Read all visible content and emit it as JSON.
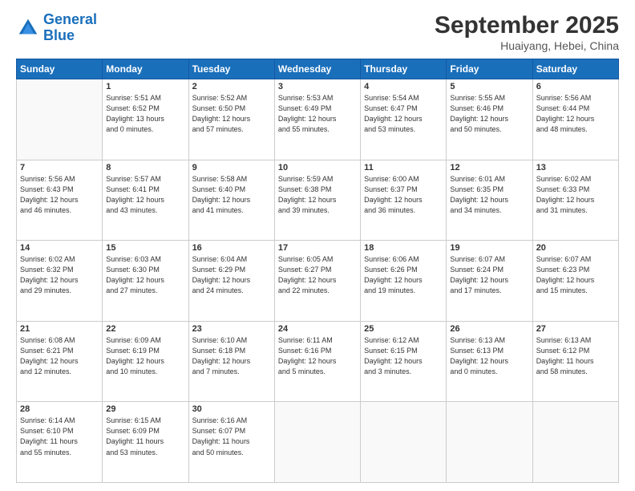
{
  "logo": {
    "line1": "General",
    "line2": "Blue"
  },
  "title": "September 2025",
  "subtitle": "Huaiyang, Hebei, China",
  "weekdays": [
    "Sunday",
    "Monday",
    "Tuesday",
    "Wednesday",
    "Thursday",
    "Friday",
    "Saturday"
  ],
  "weeks": [
    [
      {
        "day": "",
        "info": ""
      },
      {
        "day": "1",
        "info": "Sunrise: 5:51 AM\nSunset: 6:52 PM\nDaylight: 13 hours\nand 0 minutes."
      },
      {
        "day": "2",
        "info": "Sunrise: 5:52 AM\nSunset: 6:50 PM\nDaylight: 12 hours\nand 57 minutes."
      },
      {
        "day": "3",
        "info": "Sunrise: 5:53 AM\nSunset: 6:49 PM\nDaylight: 12 hours\nand 55 minutes."
      },
      {
        "day": "4",
        "info": "Sunrise: 5:54 AM\nSunset: 6:47 PM\nDaylight: 12 hours\nand 53 minutes."
      },
      {
        "day": "5",
        "info": "Sunrise: 5:55 AM\nSunset: 6:46 PM\nDaylight: 12 hours\nand 50 minutes."
      },
      {
        "day": "6",
        "info": "Sunrise: 5:56 AM\nSunset: 6:44 PM\nDaylight: 12 hours\nand 48 minutes."
      }
    ],
    [
      {
        "day": "7",
        "info": "Sunrise: 5:56 AM\nSunset: 6:43 PM\nDaylight: 12 hours\nand 46 minutes."
      },
      {
        "day": "8",
        "info": "Sunrise: 5:57 AM\nSunset: 6:41 PM\nDaylight: 12 hours\nand 43 minutes."
      },
      {
        "day": "9",
        "info": "Sunrise: 5:58 AM\nSunset: 6:40 PM\nDaylight: 12 hours\nand 41 minutes."
      },
      {
        "day": "10",
        "info": "Sunrise: 5:59 AM\nSunset: 6:38 PM\nDaylight: 12 hours\nand 39 minutes."
      },
      {
        "day": "11",
        "info": "Sunrise: 6:00 AM\nSunset: 6:37 PM\nDaylight: 12 hours\nand 36 minutes."
      },
      {
        "day": "12",
        "info": "Sunrise: 6:01 AM\nSunset: 6:35 PM\nDaylight: 12 hours\nand 34 minutes."
      },
      {
        "day": "13",
        "info": "Sunrise: 6:02 AM\nSunset: 6:33 PM\nDaylight: 12 hours\nand 31 minutes."
      }
    ],
    [
      {
        "day": "14",
        "info": "Sunrise: 6:02 AM\nSunset: 6:32 PM\nDaylight: 12 hours\nand 29 minutes."
      },
      {
        "day": "15",
        "info": "Sunrise: 6:03 AM\nSunset: 6:30 PM\nDaylight: 12 hours\nand 27 minutes."
      },
      {
        "day": "16",
        "info": "Sunrise: 6:04 AM\nSunset: 6:29 PM\nDaylight: 12 hours\nand 24 minutes."
      },
      {
        "day": "17",
        "info": "Sunrise: 6:05 AM\nSunset: 6:27 PM\nDaylight: 12 hours\nand 22 minutes."
      },
      {
        "day": "18",
        "info": "Sunrise: 6:06 AM\nSunset: 6:26 PM\nDaylight: 12 hours\nand 19 minutes."
      },
      {
        "day": "19",
        "info": "Sunrise: 6:07 AM\nSunset: 6:24 PM\nDaylight: 12 hours\nand 17 minutes."
      },
      {
        "day": "20",
        "info": "Sunrise: 6:07 AM\nSunset: 6:23 PM\nDaylight: 12 hours\nand 15 minutes."
      }
    ],
    [
      {
        "day": "21",
        "info": "Sunrise: 6:08 AM\nSunset: 6:21 PM\nDaylight: 12 hours\nand 12 minutes."
      },
      {
        "day": "22",
        "info": "Sunrise: 6:09 AM\nSunset: 6:19 PM\nDaylight: 12 hours\nand 10 minutes."
      },
      {
        "day": "23",
        "info": "Sunrise: 6:10 AM\nSunset: 6:18 PM\nDaylight: 12 hours\nand 7 minutes."
      },
      {
        "day": "24",
        "info": "Sunrise: 6:11 AM\nSunset: 6:16 PM\nDaylight: 12 hours\nand 5 minutes."
      },
      {
        "day": "25",
        "info": "Sunrise: 6:12 AM\nSunset: 6:15 PM\nDaylight: 12 hours\nand 3 minutes."
      },
      {
        "day": "26",
        "info": "Sunrise: 6:13 AM\nSunset: 6:13 PM\nDaylight: 12 hours\nand 0 minutes."
      },
      {
        "day": "27",
        "info": "Sunrise: 6:13 AM\nSunset: 6:12 PM\nDaylight: 11 hours\nand 58 minutes."
      }
    ],
    [
      {
        "day": "28",
        "info": "Sunrise: 6:14 AM\nSunset: 6:10 PM\nDaylight: 11 hours\nand 55 minutes."
      },
      {
        "day": "29",
        "info": "Sunrise: 6:15 AM\nSunset: 6:09 PM\nDaylight: 11 hours\nand 53 minutes."
      },
      {
        "day": "30",
        "info": "Sunrise: 6:16 AM\nSunset: 6:07 PM\nDaylight: 11 hours\nand 50 minutes."
      },
      {
        "day": "",
        "info": ""
      },
      {
        "day": "",
        "info": ""
      },
      {
        "day": "",
        "info": ""
      },
      {
        "day": "",
        "info": ""
      }
    ]
  ]
}
